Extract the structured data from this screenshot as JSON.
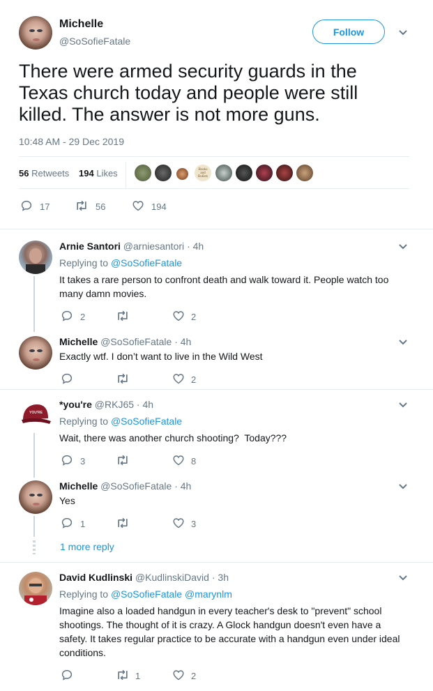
{
  "main_tweet": {
    "name": "Michelle",
    "handle": "@SoSofieFatale",
    "follow_label": "Follow",
    "text": "There were armed security guards in the Texas church today and people were still killed. The answer is not more guns.",
    "timestamp": "10:48 AM - 29 Dec 2019",
    "retweets_count": "56",
    "retweets_label": "Retweets",
    "likes_count": "194",
    "likes_label": "Likes",
    "liker_avatar_text": "Books and Bullets",
    "actions": {
      "replies": "17",
      "retweets": "56",
      "likes": "194"
    }
  },
  "replies": [
    {
      "name": "Arnie Santori",
      "handle": "@arniesantori",
      "time": "· 4h",
      "replying_label": "Replying to",
      "replying_to": "@SoSofieFatale",
      "text": "It takes a rare person to confront death and walk toward it. People watch too many damn movies.",
      "replies": "2",
      "retweets": "",
      "likes": "2"
    },
    {
      "name": "Michelle",
      "handle": "@SoSofieFatale",
      "time": "· 4h",
      "text": "Exactly wtf. I don’t want to live in the Wild West",
      "replies": "",
      "retweets": "",
      "likes": "2"
    },
    {
      "name": "*you're",
      "handle": "@RKJ65",
      "time": "· 4h",
      "replying_label": "Replying to",
      "replying_to": "@SoSofieFatale",
      "text": "Wait, there was another church shooting?  Today???",
      "replies": "3",
      "retweets": "",
      "likes": "8",
      "hat_text": "YOU'RE"
    },
    {
      "name": "Michelle",
      "handle": "@SoSofieFatale",
      "time": "· 4h",
      "text": "Yes",
      "replies": "1",
      "retweets": "",
      "likes": "3",
      "more_replies": "1 more reply"
    },
    {
      "name": "David Kudlinski",
      "handle": "@KudlinskiDavid",
      "time": "· 3h",
      "replying_label": "Replying to",
      "replying_to": "@SoSofieFatale @marynlm",
      "text": "Imagine also a loaded handgun in every teacher's desk to \"prevent\" school shootings. The thought of it is crazy. A Glock handgun doesn't even have a safety. It takes regular practice to be accurate with a handgun even under ideal conditions.",
      "replies": "",
      "retweets": "1",
      "likes": "2"
    }
  ],
  "colors": {
    "accent": "#1b95e0",
    "muted": "#657786",
    "text": "#14171a",
    "divider": "#e6ecf0"
  }
}
